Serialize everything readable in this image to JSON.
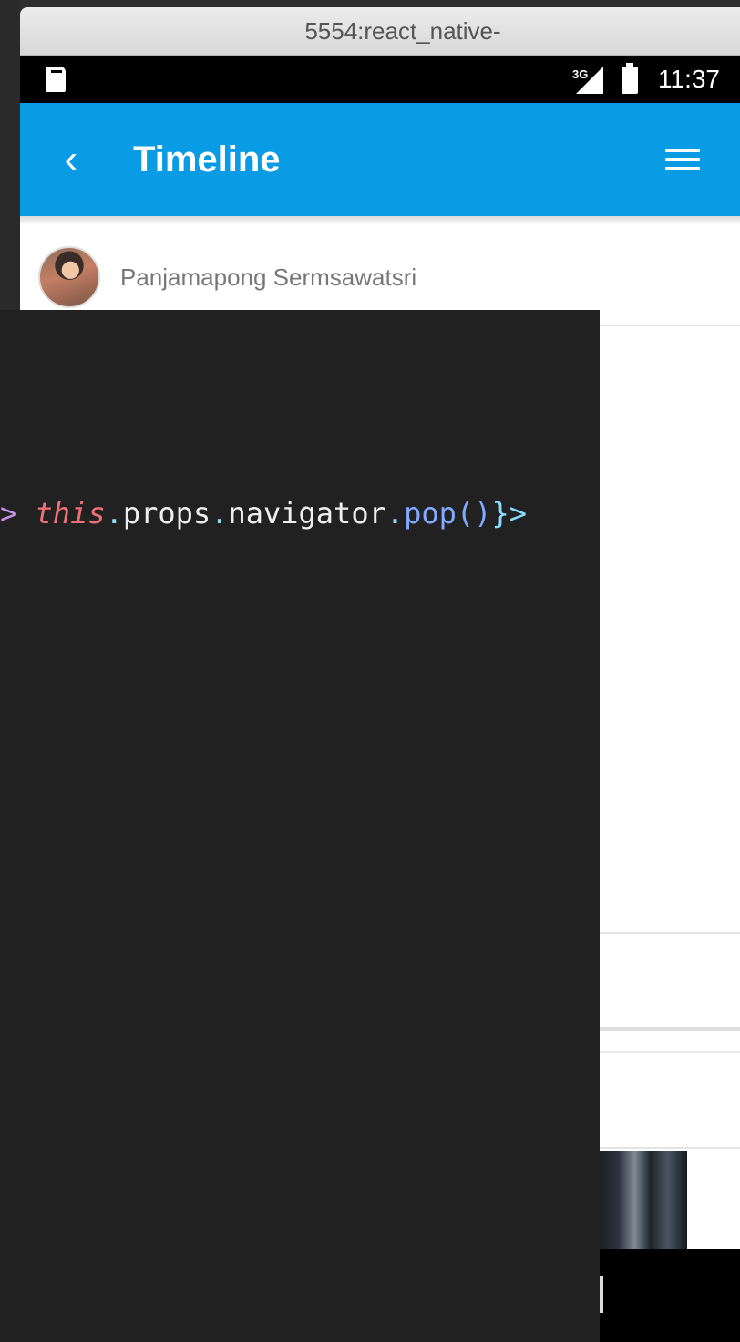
{
  "window": {
    "title": "5554:react_native-"
  },
  "status_bar": {
    "network": "3G",
    "time": "11:37",
    "icons": [
      "sd-card-icon",
      "signal-icon",
      "battery-icon"
    ]
  },
  "app_bar": {
    "title": "Timeline",
    "back_icon": "chevron-left",
    "menu_icon": "hamburger-menu",
    "color": "#0a9be5"
  },
  "post": {
    "author": "Panjamapong Sermsawatsri"
  },
  "code_overlay": {
    "tokens": {
      "arrow": ">",
      "keyword": "this",
      "dot1": ".",
      "props": "props",
      "dot2": ".",
      "navigator": "navigator",
      "dot3": ".",
      "method": "pop()",
      "close": "}>"
    },
    "background": "#212121"
  }
}
